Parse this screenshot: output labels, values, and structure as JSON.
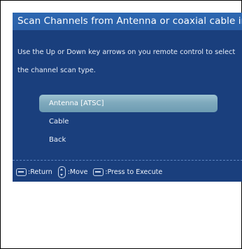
{
  "screen": {
    "title": "Scan Channels from Antenna or coaxial cable input",
    "instruction_line1": "Use the Up or Down key arrows on you remote control to select",
    "instruction_line2": "the channel scan type."
  },
  "menu": {
    "items": [
      {
        "label": "Antenna [ATSC]",
        "selected": true
      },
      {
        "label": "Cable",
        "selected": false
      },
      {
        "label": "Back",
        "selected": false
      }
    ]
  },
  "footer": {
    "return_label": ":Return",
    "move_label": ":Move",
    "execute_label": ":Press to Execute",
    "icons": [
      "menu-key-icon",
      "updown-key-icon",
      "enter-key-icon"
    ]
  },
  "colors": {
    "screen_bg": "#1a3f7d",
    "title_band": "#2c67b1",
    "highlight": "#8fb7c9"
  }
}
